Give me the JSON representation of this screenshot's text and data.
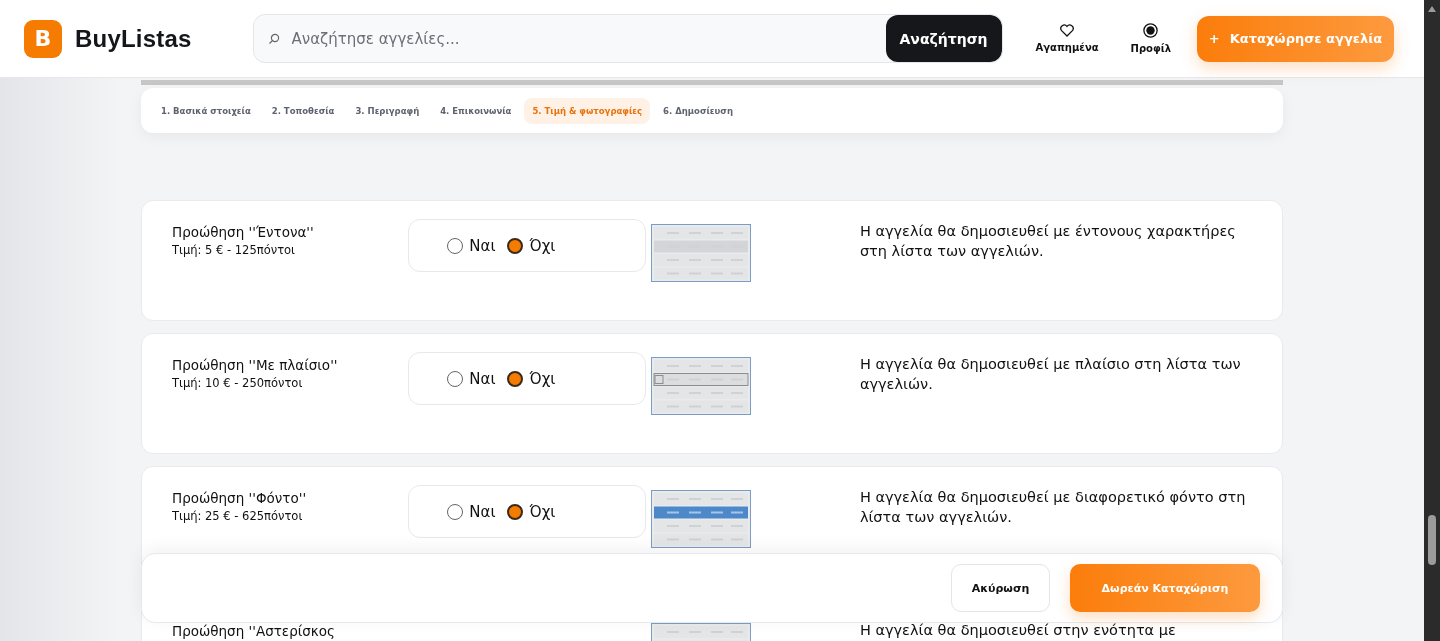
{
  "header": {
    "logo_letter": "B",
    "brand": "BuyListas",
    "search": {
      "placeholder": "Αναζήτησε αγγελίες..."
    },
    "search_button": "Αναζήτηση",
    "nav": [
      {
        "label": "Αγαπημένα",
        "kind": "heart"
      },
      {
        "label": "Προφίλ",
        "kind": "profile"
      }
    ],
    "post_button": {
      "icon": "+",
      "label": "Καταχώρησε αγγελία"
    }
  },
  "steps": [
    {
      "label": "1. Βασικά στοιχεία",
      "selected": false
    },
    {
      "label": "2. Τοποθεσία",
      "selected": false
    },
    {
      "label": "3. Περιγραφή",
      "selected": false
    },
    {
      "label": "4. Επικοινωνία",
      "selected": false
    },
    {
      "label": "5. Τιμή & φωτογραφίες",
      "selected": true
    },
    {
      "label": "6. Δημοσίευση",
      "selected": false
    }
  ],
  "promotions": [
    {
      "title": "Προώθηση ''Έντονα''",
      "price": "Τιμή: 5 € - 125πόντοι",
      "options": [
        {
          "label": "Ναι",
          "selected": false
        },
        {
          "label": "Όχι",
          "selected": true
        }
      ],
      "kind": "bold",
      "description": "Η αγγελία θα δημοσιευθεί με έντονους χαρακτήρες στη λίστα των αγγελιών."
    },
    {
      "title": "Προώθηση ''Με πλαίσιο''",
      "price": "Τιμή: 10 € - 250πόντοι",
      "options": [
        {
          "label": "Ναι",
          "selected": false
        },
        {
          "label": "Όχι",
          "selected": true
        }
      ],
      "kind": "frame",
      "description": "Η αγγελία θα δημοσιευθεί με πλαίσιο στη λίστα των αγγελιών."
    },
    {
      "title": "Προώθηση ''Φόντο''",
      "price": "Τιμή: 25 € - 625πόντοι",
      "options": [
        {
          "label": "Ναι",
          "selected": false
        },
        {
          "label": "Όχι",
          "selected": true
        }
      ],
      "kind": "background",
      "description": "Η αγγελία θα δημοσιευθεί με διαφορετικό φόντο στη λίστα των αγγελιών."
    },
    {
      "title": "Προώθηση ''Αστερίσκος",
      "kind": "plain",
      "description": "Η αγγελία θα δημοσιευθεί στην ενότητα με"
    }
  ],
  "footer": {
    "cancel": "Ακύρωση",
    "submit": "Δωρεάν Καταχώριση"
  }
}
